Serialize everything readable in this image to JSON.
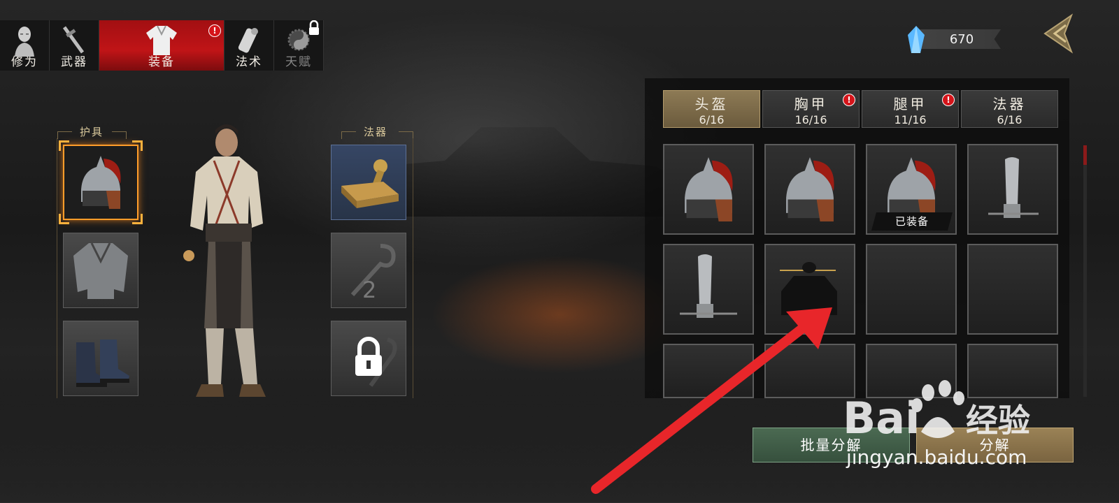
{
  "nav": {
    "tabs": [
      {
        "label": "修为",
        "icon": "cultivation-figure-icon",
        "active": false,
        "badge": false,
        "locked": false
      },
      {
        "label": "武器",
        "icon": "sword-icon",
        "active": false,
        "badge": false,
        "locked": false
      },
      {
        "label": "装备",
        "icon": "robe-icon",
        "active": true,
        "badge": true,
        "locked": false
      },
      {
        "label": "法术",
        "icon": "scroll-icon",
        "active": false,
        "badge": false,
        "locked": false
      },
      {
        "label": "天赋",
        "icon": "yin-yang-icon",
        "active": false,
        "badge": false,
        "locked": true
      }
    ],
    "badge_text": "!"
  },
  "currency": {
    "value": "670",
    "icon": "blue-crystal-icon"
  },
  "left": {
    "armor_title": "护具",
    "artifact_title": "法器",
    "armor_slots": [
      {
        "item": "helmet",
        "selected": true
      },
      {
        "item": "chest-armor",
        "selected": false
      },
      {
        "item": "boots",
        "selected": false
      }
    ],
    "artifact_slots": [
      {
        "item": "seal-stamp",
        "state": "equipped"
      },
      {
        "item": "slot-2",
        "state": "empty",
        "number": "2"
      },
      {
        "item": "slot-3",
        "state": "locked"
      }
    ]
  },
  "categories": [
    {
      "name": "头盔",
      "count": "6/16",
      "active": true,
      "badge": false
    },
    {
      "name": "胸甲",
      "count": "16/16",
      "active": false,
      "badge": true
    },
    {
      "name": "腿甲",
      "count": "11/16",
      "active": false,
      "badge": true
    },
    {
      "name": "法器",
      "count": "6/16",
      "active": false,
      "badge": false
    }
  ],
  "inventory": [
    {
      "item": "helmet",
      "equipped": false
    },
    {
      "item": "helmet",
      "equipped": false
    },
    {
      "item": "helmet",
      "equipped": true
    },
    {
      "item": "tall-hat",
      "equipped": false
    },
    {
      "item": "tall-hat",
      "equipped": false
    },
    {
      "item": "scholar-cap",
      "equipped": false
    },
    {
      "item": "empty",
      "equipped": false
    },
    {
      "item": "empty",
      "equipped": false
    }
  ],
  "equipped_label": "已装备",
  "buttons": {
    "batch": "批量分解",
    "decompose": "分解"
  },
  "watermark": {
    "brand": "Bai",
    "brand2": "经验",
    "url": "jingyan.baidu.com"
  },
  "colors": {
    "active_tab": "#c01417",
    "selected_slot": "#ff9d2a",
    "arrow": "#e8262a",
    "gold_tab": "#8d7a55"
  }
}
